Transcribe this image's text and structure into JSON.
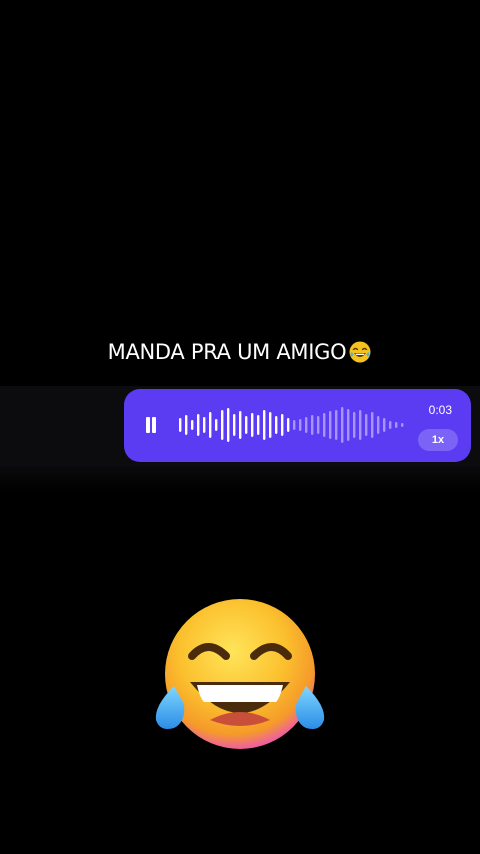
{
  "caption": {
    "text": "MANDA PRA UM AMIGO",
    "emoji_icon": "face-with-tears-of-joy-icon"
  },
  "voice_message": {
    "duration": "0:03",
    "speed": "1x",
    "progress": 0.5,
    "colors": {
      "bubble": "#5b3cf3",
      "played": "#ffffff",
      "unplayed": "#a796fa",
      "pill": "#7b63f6"
    }
  },
  "sticker": {
    "icon": "face-with-tears-of-joy-icon"
  }
}
